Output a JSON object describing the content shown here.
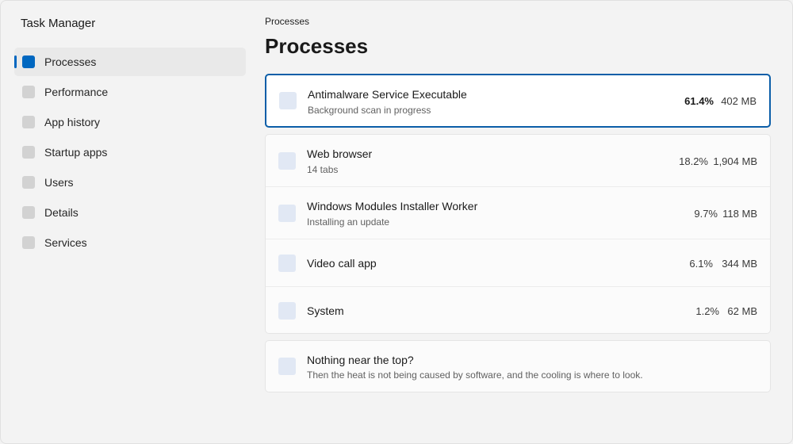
{
  "app": {
    "title": "Task Manager"
  },
  "sidebar": {
    "items": [
      {
        "label": "Processes",
        "icon": "processes-icon",
        "active": true
      },
      {
        "label": "Performance",
        "icon": "performance-icon"
      },
      {
        "label": "App history",
        "icon": "app-history-icon"
      },
      {
        "label": "Startup apps",
        "icon": "startup-apps-icon"
      },
      {
        "label": "Users",
        "icon": "users-icon"
      },
      {
        "label": "Details",
        "icon": "details-icon"
      },
      {
        "label": "Services",
        "icon": "services-icon"
      }
    ]
  },
  "main": {
    "breadcrumb": "Processes",
    "title": "Processes",
    "highlighted": {
      "name": "Antimalware Service Executable",
      "status": "Background scan in progress",
      "cpu": "61.4%",
      "memory": "402 MB"
    },
    "processes": [
      {
        "name": "Web browser",
        "status": "14 tabs",
        "cpu": "18.2%",
        "memory": "1,904 MB"
      },
      {
        "name": "Windows Modules Installer Worker",
        "status": "Installing an update",
        "cpu": "9.7%",
        "memory": "118 MB"
      },
      {
        "name": "Video call app",
        "cpu": "6.1%",
        "memory": "344 MB"
      },
      {
        "name": "System",
        "cpu": "1.2%",
        "memory": "62 MB"
      }
    ],
    "hint": {
      "title": "Nothing near the top?",
      "text": "Then the heat is not being caused by software, and the cooling is where to look."
    }
  },
  "colors": {
    "accent": "#0067c0",
    "highlight_border": "#0b5ea8",
    "background": "#f3f3f3",
    "icon_placeholder": "#e1e8f4"
  }
}
